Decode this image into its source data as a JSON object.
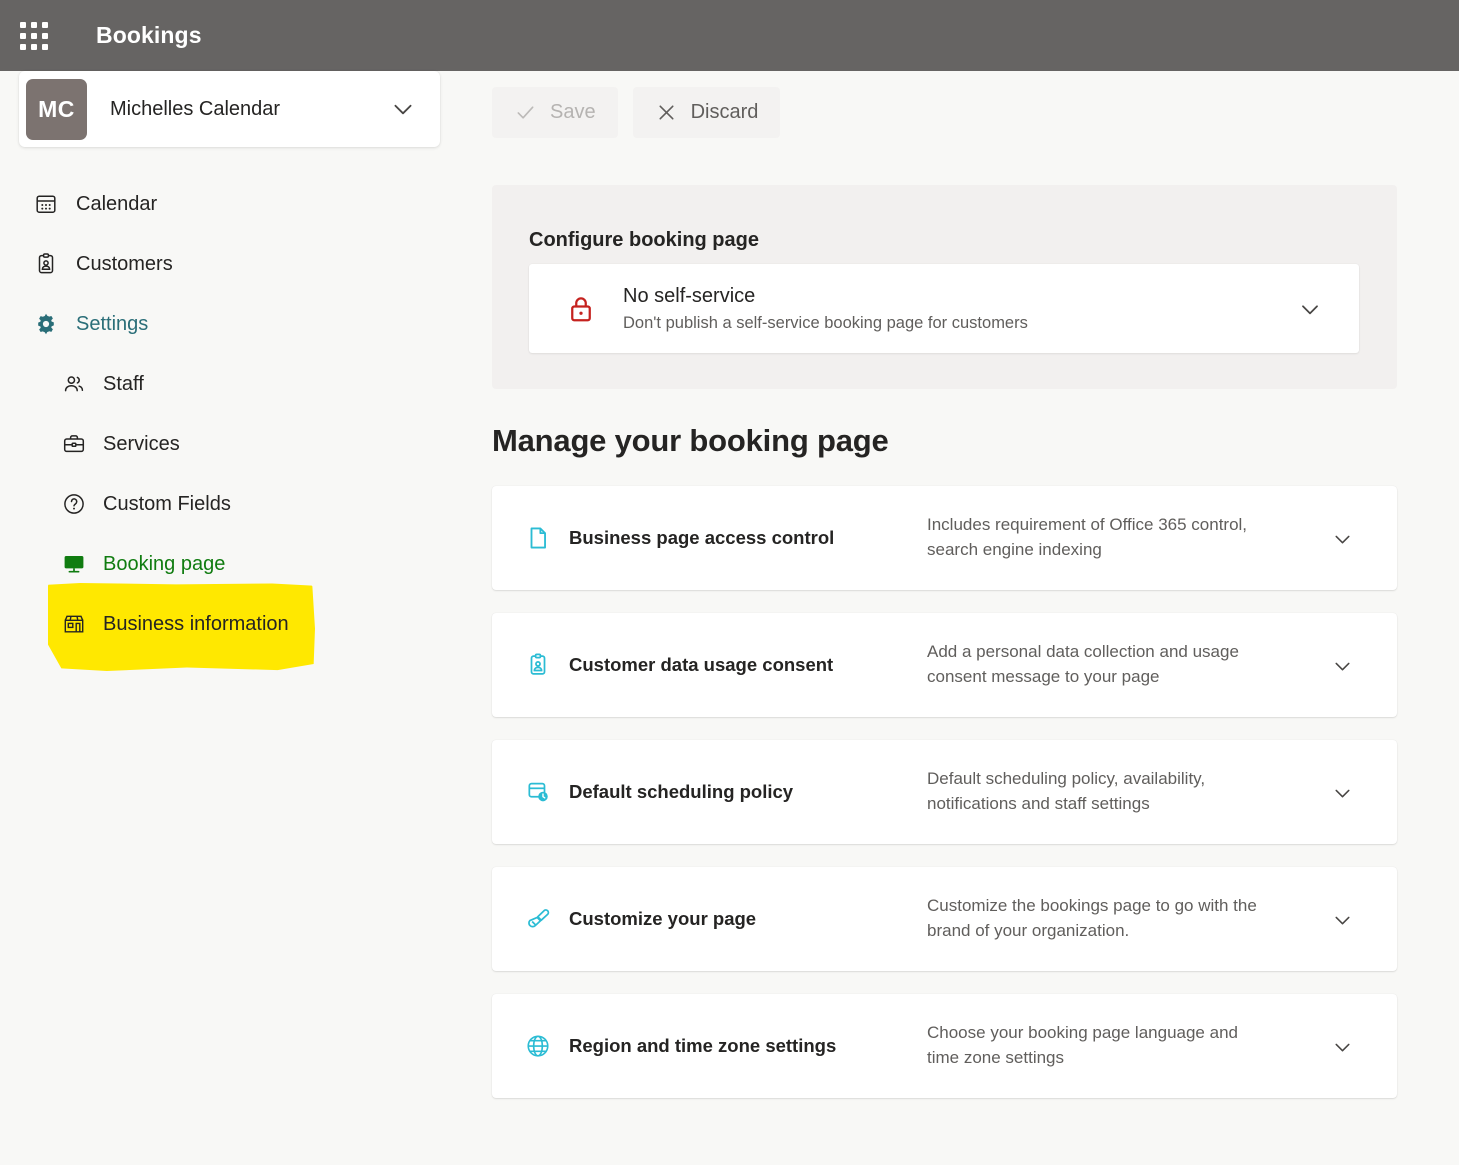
{
  "topbar": {
    "waffle_icon": "app-launcher-grid-icon",
    "title": "Bookings"
  },
  "account": {
    "initials": "MC",
    "name": "Michelles Calendar",
    "chevron_icon": "chevron-down-icon"
  },
  "sidebar": {
    "items": [
      {
        "label": "Calendar",
        "icon": "calendar-icon",
        "level": "top",
        "state": "normal"
      },
      {
        "label": "Customers",
        "icon": "customers-card-icon",
        "level": "top",
        "state": "normal"
      },
      {
        "label": "Settings",
        "icon": "gear-icon",
        "level": "top",
        "state": "accent"
      },
      {
        "label": "Staff",
        "icon": "people-icon",
        "level": "sub",
        "state": "normal"
      },
      {
        "label": "Services",
        "icon": "briefcase-icon",
        "level": "sub",
        "state": "normal"
      },
      {
        "label": "Custom Fields",
        "icon": "question-circle-icon",
        "level": "sub",
        "state": "normal"
      },
      {
        "label": "Booking page",
        "icon": "monitor-icon",
        "level": "sub",
        "state": "selected"
      },
      {
        "label": "Business information",
        "icon": "storefront-icon",
        "level": "sub",
        "state": "normal"
      }
    ],
    "highlight": {
      "target": "Booking page",
      "color": "#ffe800"
    }
  },
  "toolbar": {
    "save_label": "Save",
    "save_icon": "checkmark-icon",
    "save_enabled": false,
    "discard_label": "Discard",
    "discard_icon": "close-x-icon",
    "discard_enabled": true
  },
  "configure": {
    "title": "Configure booking page",
    "option": {
      "icon": "lock-icon",
      "icon_color": "#c5221f",
      "title": "No self-service",
      "subtitle": "Don't publish a self-service booking page for customers",
      "chevron_icon": "chevron-down-icon"
    }
  },
  "manage": {
    "section_title": "Manage your booking page",
    "cards": [
      {
        "icon": "page-document-icon",
        "title": "Business page access control",
        "description": "Includes requirement of Office 365 control, search engine indexing",
        "chevron_icon": "chevron-down-icon"
      },
      {
        "icon": "contact-card-icon",
        "title": "Customer data usage consent",
        "description": "Add a personal data collection and usage consent message to your page",
        "chevron_icon": "chevron-down-icon"
      },
      {
        "icon": "calendar-clock-icon",
        "title": "Default scheduling policy",
        "description": "Default scheduling policy, availability, notifications and staff settings",
        "chevron_icon": "chevron-down-icon"
      },
      {
        "icon": "paintbrush-icon",
        "title": "Customize your page",
        "description": "Customize the bookings page to go with the brand of your organization.",
        "chevron_icon": "chevron-down-icon"
      },
      {
        "icon": "globe-icon",
        "title": "Region and time zone settings",
        "description": "Choose your booking page language and time zone settings",
        "chevron_icon": "chevron-down-icon"
      }
    ]
  },
  "colors": {
    "topbar_bg": "#666463",
    "page_bg": "#f8f8f6",
    "panel_bg": "#f2f0ef",
    "accent_teal": "#2a6e78",
    "icon_cyan": "#2bbcd4",
    "selected_green": "#107c10",
    "highlight_yellow": "#ffe800",
    "lock_red": "#c5221f"
  }
}
